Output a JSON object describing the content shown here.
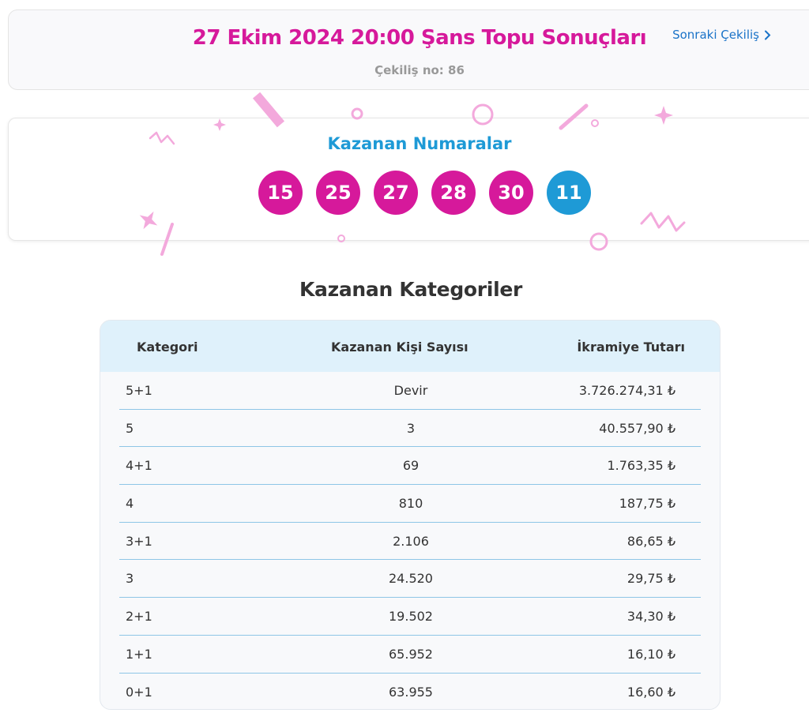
{
  "header": {
    "title": "27 Ekim 2024 20:00 Şans Topu Sonuçları",
    "draw_no": "Çekiliş no: 86",
    "next_label": "Sonraki Çekiliş"
  },
  "winning": {
    "title": "Kazanan Numaralar",
    "numbers": [
      "15",
      "25",
      "27",
      "28",
      "30"
    ],
    "plus": "11"
  },
  "categories": {
    "title": "Kazanan Kategoriler",
    "headers": [
      "Kategori",
      "Kazanan Kişi Sayısı",
      "İkramiye Tutarı"
    ],
    "rows": [
      [
        "5+1",
        "Devir",
        "3.726.274,31 ₺"
      ],
      [
        "5",
        "3",
        "40.557,90 ₺"
      ],
      [
        "4+1",
        "69",
        "1.763,35 ₺"
      ],
      [
        "4",
        "810",
        "187,75 ₺"
      ],
      [
        "3+1",
        "2.106",
        "86,65 ₺"
      ],
      [
        "3",
        "24.520",
        "29,75 ₺"
      ],
      [
        "2+1",
        "19.502",
        "34,30 ₺"
      ],
      [
        "1+1",
        "65.952",
        "16,10 ₺"
      ],
      [
        "0+1",
        "63.955",
        "16,60 ₺"
      ]
    ]
  },
  "colors": {
    "accent_pink": "#d6199b",
    "accent_blue": "#1e9ad6",
    "link_blue": "#1a73c8",
    "table_head_bg": "#dff1fb"
  }
}
